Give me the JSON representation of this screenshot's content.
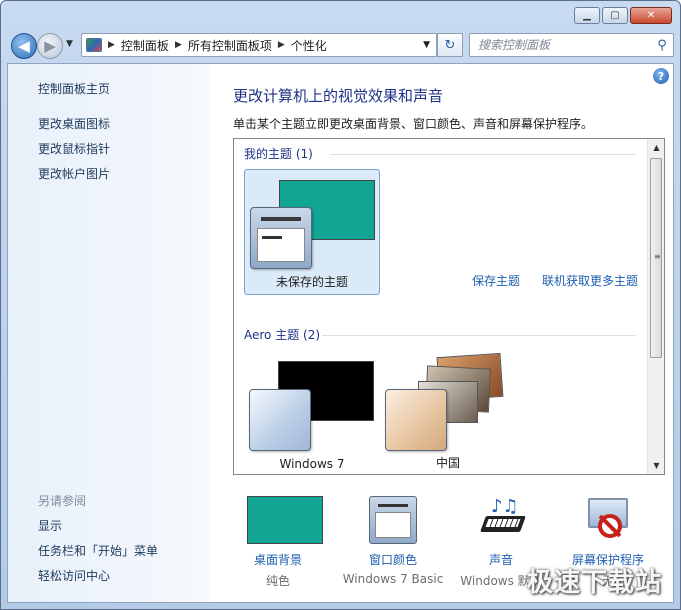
{
  "window": {
    "minimize_glyph": "▁",
    "maximize_glyph": "▢",
    "close_glyph": "✕"
  },
  "nav": {
    "back_glyph": "◀",
    "forward_glyph": "▶",
    "dropdown_glyph": "▼",
    "breadcrumbs": [
      "控制面板",
      "所有控制面板项",
      "个性化"
    ],
    "breadcrumb_separator": "▶",
    "refresh_glyph": "↻",
    "search_placeholder": "搜索控制面板",
    "search_glyph": "⚲"
  },
  "sidebar": {
    "home_link": "控制面板主页",
    "tasks": [
      "更改桌面图标",
      "更改鼠标指针",
      "更改帐户图片"
    ],
    "see_also_header": "另请参阅",
    "see_also": [
      "显示",
      "任务栏和「开始」菜单",
      "轻松访问中心"
    ]
  },
  "main": {
    "help_glyph": "?",
    "title": "更改计算机上的视觉效果和声音",
    "description": "单击某个主题立即更改桌面背景、窗口颜色、声音和屏幕保护程序。"
  },
  "themes": {
    "my_themes_header": "我的主题 (1)",
    "my_themes": [
      {
        "label": "未保存的主题",
        "selected": true
      }
    ],
    "save_link": "保存主题",
    "online_link": "联机获取更多主题",
    "aero_header": "Aero 主题 (2)",
    "aero_themes": [
      {
        "label": "Windows 7"
      },
      {
        "label": "中国"
      }
    ]
  },
  "options": [
    {
      "name": "桌面背景",
      "value": "纯色",
      "icon": "desktop-background-icon"
    },
    {
      "name": "窗口颜色",
      "value": "Windows 7 Basic",
      "icon": "window-color-icon"
    },
    {
      "name": "声音",
      "value": "Windows 默认",
      "icon": "sound-icon"
    },
    {
      "name": "屏幕保护程序",
      "value": "无",
      "icon": "screensaver-icon"
    }
  ],
  "colors": {
    "accent_teal": "#12a594",
    "link_blue": "#1e5fb0",
    "title_blue": "#1e3287"
  },
  "watermark": "极速下载站"
}
